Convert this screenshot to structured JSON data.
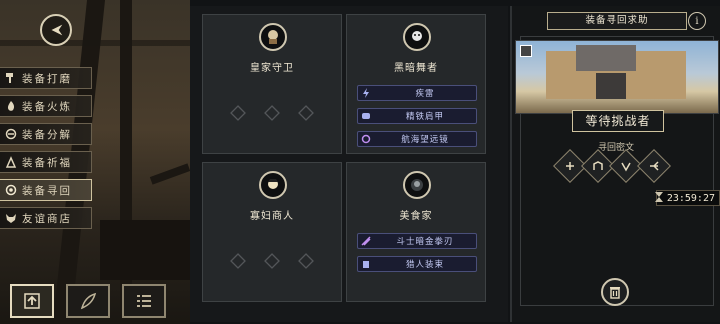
{
  "menu": {
    "items": [
      {
        "label": "装备打磨",
        "icon": "hammer-icon",
        "active": false
      },
      {
        "label": "装备火炼",
        "icon": "flame-icon",
        "active": false
      },
      {
        "label": "装备分解",
        "icon": "swirl-icon",
        "active": false
      },
      {
        "label": "装备祈福",
        "icon": "hands-icon",
        "active": false
      },
      {
        "label": "装备寻回",
        "icon": "spiral-icon",
        "active": true
      },
      {
        "label": "友谊商店",
        "icon": "fox-icon",
        "active": false
      }
    ]
  },
  "cards": [
    {
      "name": "皇家守卫",
      "buffs": []
    },
    {
      "name": "黑暗舞者",
      "buffs": [
        "疾雷",
        "精铁肩甲",
        "航海望远镜"
      ]
    },
    {
      "name": "寡妇商人",
      "buffs": []
    },
    {
      "name": "美食家",
      "buffs": [
        "斗士暗金拳刃",
        "猎人装束"
      ]
    }
  ],
  "right_panel": {
    "title": "装备寻回求助",
    "status": "等待挑战者",
    "section_title": "寻回密文",
    "timer": "23:59:27"
  },
  "colors": {
    "accent": "#cfc39f",
    "buff_bg": "#1a1c30",
    "buff_text": "#c3c9f2"
  }
}
